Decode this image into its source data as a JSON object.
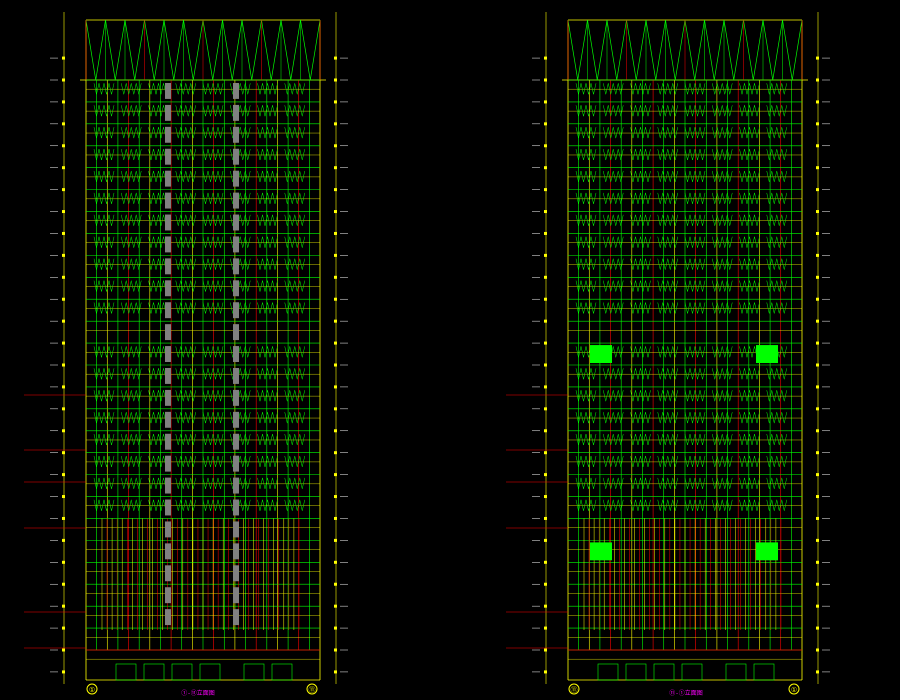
{
  "colors": {
    "background": "#000000",
    "frame": "#ffff00",
    "grid_green": "#00ff00",
    "grid_red": "#ff0000",
    "panel": "#808080",
    "bright_green": "#00ff00",
    "label_white": "#ffffff",
    "magenta": "#ff00ff"
  },
  "elevations": [
    {
      "name": "left-elevation",
      "floors": 26,
      "lower_floors_with_bays": 6,
      "gray_panel_columns": true,
      "green_highlight_floors": [],
      "axis_start_label": "①",
      "axis_end_label": "⑪",
      "title_label": "①-⑪立面图"
    },
    {
      "name": "right-elevation",
      "floors": 26,
      "lower_floors_with_bays": 6,
      "gray_panel_columns": false,
      "green_highlight_floors": [
        12,
        21
      ],
      "axis_start_label": "⑪",
      "axis_end_label": "①",
      "title_label": "⑪-①立面图"
    }
  ]
}
